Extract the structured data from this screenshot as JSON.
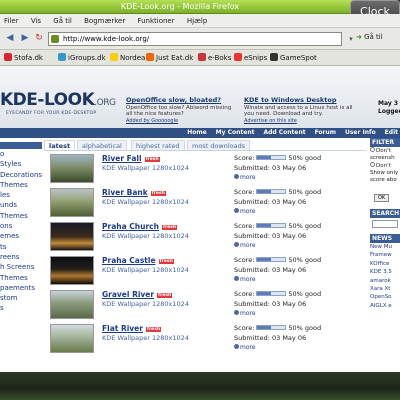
{
  "window": {
    "title": "KDE-Look.org - Mozilla Firefox",
    "clock": "Clock"
  },
  "menu": [
    "Filer",
    "Vis",
    "Gå til",
    "Bogmærker",
    "Funktioner",
    "Hjælp"
  ],
  "nav": {
    "url": "http://www.kde-look.org/",
    "go_label": "Gå til"
  },
  "bookmarks": [
    "Stofa.dk",
    "iGroups.dk",
    "Nordea",
    "Just Eat.dk",
    "e-Boks",
    "eSnips",
    "GameSpot"
  ],
  "colors": {
    "title_green": "#7db126",
    "site_blue": "#2f4f85",
    "link_blue": "#1a3a8c",
    "fresh_red": "#e13a3a"
  },
  "site": {
    "logo": "KDE-LOOK",
    "logo_suffix": ".ORG",
    "tagline": "EYECANDY FOR YOUR KDE-DESKTOP",
    "news": [
      {
        "title": "OpenOffice slow, bloated?",
        "text": "OpenOffice too slow? Abiword missing all the nice features?",
        "foot": "Added by Gooooogle"
      },
      {
        "title": "KDE to Windows Desktop",
        "text": "Winate and access to a Linux host is all you need. Download and try.",
        "foot": "Advertise on this site"
      }
    ],
    "date_line1": "May 3",
    "date_line2": "Logged",
    "topnav": [
      "Home",
      "My Content",
      "Add Content",
      "Forum",
      "User Info",
      "Edit"
    ]
  },
  "sidebar_left": [
    "o",
    "Styles",
    "Decorations",
    "",
    "",
    "Themes",
    "les",
    "unds",
    "Themes",
    "ons",
    "emes",
    "ts",
    "reens",
    "h Screens",
    "Themes",
    "paements",
    "stom",
    "s"
  ],
  "tabs": [
    "latest",
    "alphabetical",
    "highest rated",
    "most downloads"
  ],
  "entries": [
    {
      "title": "River Fall",
      "fresh": "fresh",
      "sub": "KDE Wallpaper 1280x1024",
      "score_label": "Score:",
      "score": 50,
      "score_text": "50% good",
      "submitted": "Submitted: 03 May 06",
      "more": "more"
    },
    {
      "title": "River Bank",
      "fresh": "fresh",
      "sub": "KDE Wallpaper 1280x1024",
      "score_label": "Score:",
      "score": 50,
      "score_text": "50% good",
      "submitted": "Submitted: 03 May 06",
      "more": "more"
    },
    {
      "title": "Praha Church",
      "fresh": "fresh",
      "sub": "KDE Wallpaper 1280x1024",
      "score_label": "Score:",
      "score": 50,
      "score_text": "50% good",
      "submitted": "Submitted: 03 May 06",
      "more": "more"
    },
    {
      "title": "Praha Castle",
      "fresh": "fresh",
      "sub": "KDE Wallpaper 1280x1024",
      "score_label": "Score:",
      "score": 50,
      "score_text": "50% good",
      "submitted": "Submitted: 03 May 06",
      "more": "more"
    },
    {
      "title": "Gravel River",
      "fresh": "fresh",
      "sub": "KDE Wallpaper 1280x1024",
      "score_label": "Score:",
      "score": 50,
      "score_text": "50% good",
      "submitted": "Submitted: 03 May 06",
      "more": "more"
    },
    {
      "title": "Flat River",
      "fresh": "fresh",
      "sub": "KDE Wallpaper 1280x1024",
      "score_label": "Score:",
      "score": 50,
      "score_text": "50% good",
      "submitted": "Submitted: 03 May 06",
      "more": "more"
    }
  ],
  "sidebar_right": {
    "filter_title": "FILTER",
    "filter_text": [
      "Don't",
      "screensh",
      "Don't",
      "Show only",
      "score abo"
    ],
    "ok_label": "OK",
    "search_title": "SEARCH",
    "news_title": "NEWS",
    "news_items": [
      "New Mu",
      "Framew",
      "KOffice",
      "KDE 3.5",
      "amarok",
      "Xara Xt",
      "OpenSo",
      "AIGLX e"
    ]
  }
}
